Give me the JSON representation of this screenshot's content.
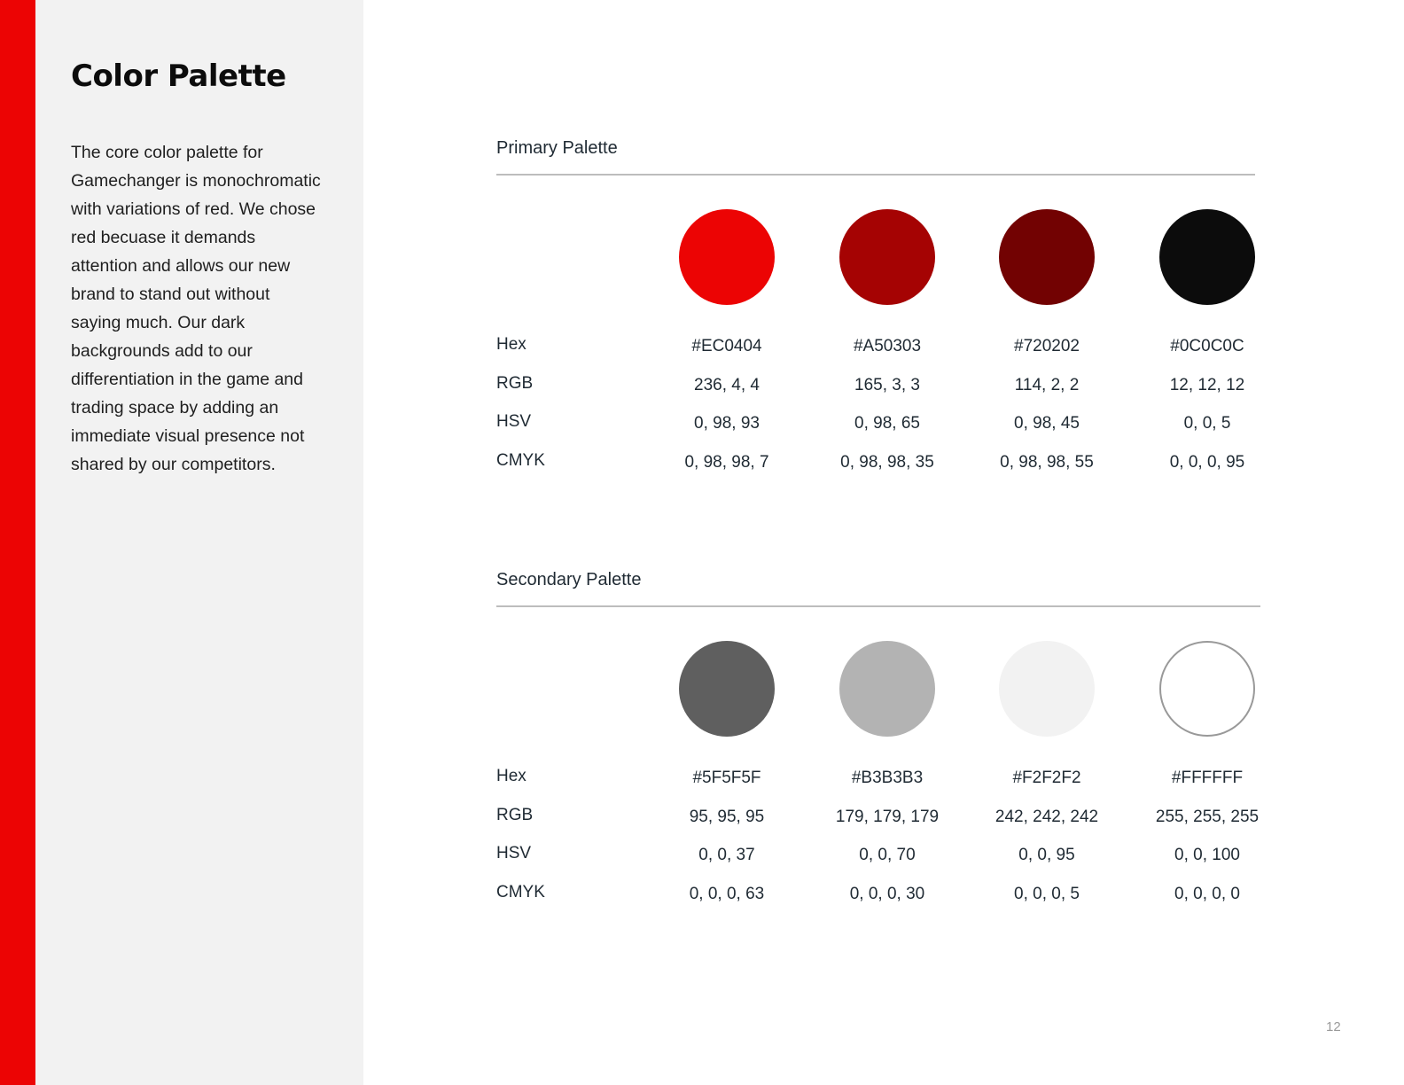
{
  "page": {
    "title": "Color Palette",
    "intro": "The core color palette for Gamechanger is monochromatic with variations of red. We chose red becuase it demands attention and allows our new brand to stand out without saying much. Our dark backgrounds add to our differentiation in the game and trading space by adding an immediate visual presence not shared by our competitors.",
    "page_number": "12",
    "accent_color": "#EC0404",
    "sidebar_color": "#F2F2F2"
  },
  "row_labels": {
    "hex": "Hex",
    "rgb": "RGB",
    "hsv": "HSV",
    "cmyk": "CMYK"
  },
  "primary": {
    "label": "Primary Palette",
    "colors": [
      {
        "swatch": "#EC0404",
        "hex": "#EC0404",
        "rgb": "236, 4, 4",
        "hsv": "0, 98, 93",
        "cmyk": "0, 98, 98, 7"
      },
      {
        "swatch": "#A50303",
        "hex": "#A50303",
        "rgb": "165, 3, 3",
        "hsv": "0, 98, 65",
        "cmyk": "0, 98, 98, 35"
      },
      {
        "swatch": "#720202",
        "hex": "#720202",
        "rgb": "114, 2, 2",
        "hsv": "0, 98, 45",
        "cmyk": "0, 98, 98, 55"
      },
      {
        "swatch": "#0C0C0C",
        "hex": "#0C0C0C",
        "rgb": "12, 12, 12",
        "hsv": "0, 0, 5",
        "cmyk": "0, 0, 0, 95"
      }
    ]
  },
  "secondary": {
    "label": "Secondary Palette",
    "colors": [
      {
        "swatch": "#5F5F5F",
        "hex": "#5F5F5F",
        "rgb": "95, 95, 95",
        "hsv": "0, 0, 37",
        "cmyk": "0, 0, 0, 63"
      },
      {
        "swatch": "#B3B3B3",
        "hex": "#B3B3B3",
        "rgb": "179, 179, 179",
        "hsv": "0, 0, 70",
        "cmyk": "0, 0, 0, 30"
      },
      {
        "swatch": "#F2F2F2",
        "hex": "#F2F2F2",
        "rgb": "242, 242, 242",
        "hsv": "0, 0, 95",
        "cmyk": "0, 0, 0, 5"
      },
      {
        "swatch": "#FFFFFF",
        "hex": "#FFFFFF",
        "rgb": "255, 255, 255",
        "hsv": "0, 0, 100",
        "cmyk": "0, 0, 0, 0"
      }
    ]
  }
}
